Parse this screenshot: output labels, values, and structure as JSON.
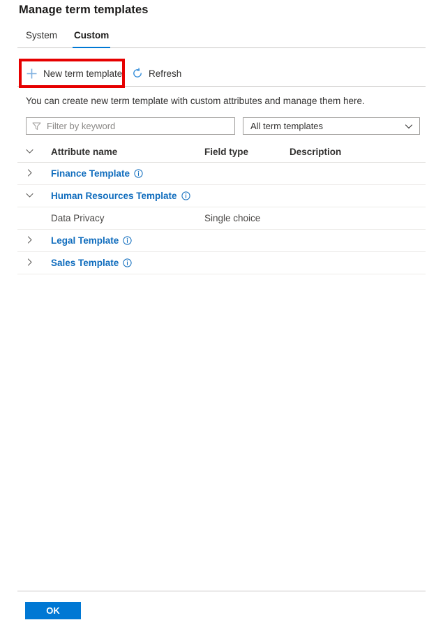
{
  "page": {
    "title": "Manage term templates",
    "description": "You can create new term template with custom attributes and manage them here."
  },
  "tabs": [
    {
      "id": "system",
      "label": "System",
      "active": false
    },
    {
      "id": "custom",
      "label": "Custom",
      "active": true
    }
  ],
  "commandbar": {
    "new_label": "New term template",
    "new_icon": "plus-icon",
    "refresh_label": "Refresh",
    "refresh_icon": "refresh-icon"
  },
  "highlight": {
    "color": "#e60000",
    "target": "New term template"
  },
  "filters": {
    "keyword": {
      "value": "",
      "placeholder": "Filter by keyword",
      "icon": "filter-icon"
    },
    "template_select": {
      "selected": "All term templates",
      "icon": "chevron-down-icon"
    }
  },
  "table": {
    "columns": [
      {
        "key": "name",
        "label": "Attribute name"
      },
      {
        "key": "type",
        "label": "Field type"
      },
      {
        "key": "desc",
        "label": "Description"
      }
    ],
    "header_toggle_icon": "chevron-down-icon",
    "rows": [
      {
        "name": "Finance Template",
        "type": "",
        "desc": "",
        "level": "template",
        "expanded": false,
        "toggle_icon": "chevron-right-icon",
        "info_icon": "info-icon"
      },
      {
        "name": "Human Resources Template",
        "type": "",
        "desc": "",
        "level": "template",
        "expanded": true,
        "toggle_icon": "chevron-down-icon",
        "info_icon": "info-icon"
      },
      {
        "name": "Data Privacy",
        "type": "Single choice",
        "desc": "",
        "level": "attribute",
        "expanded": false,
        "toggle_icon": "",
        "info_icon": ""
      },
      {
        "name": "Legal Template",
        "type": "",
        "desc": "",
        "level": "template",
        "expanded": false,
        "toggle_icon": "chevron-right-icon",
        "info_icon": "info-icon"
      },
      {
        "name": "Sales Template",
        "type": "",
        "desc": "",
        "level": "template",
        "expanded": false,
        "toggle_icon": "chevron-right-icon",
        "info_icon": "info-icon"
      }
    ]
  },
  "footer": {
    "ok_label": "OK"
  },
  "colors": {
    "accent": "#0078d4",
    "link": "#0f6cbd",
    "highlight": "#e60000",
    "text": "#323130",
    "border": "#c8c6c4"
  }
}
